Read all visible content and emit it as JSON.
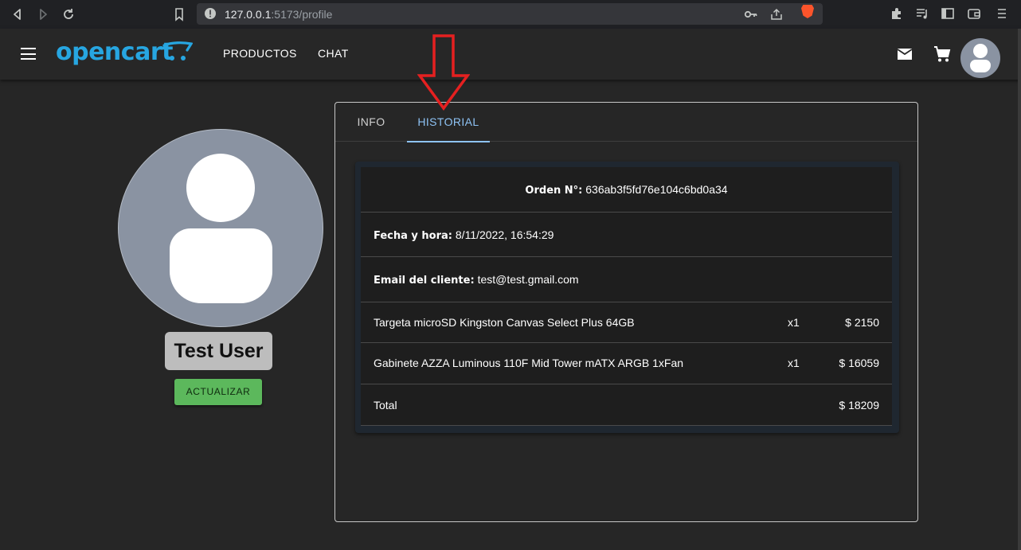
{
  "browser": {
    "url_host": "127.0.0.1",
    "url_path": ":5173/profile"
  },
  "header": {
    "logo": "opencart",
    "nav": [
      "PRODUCTOS",
      "CHAT"
    ]
  },
  "profile": {
    "user_name": "Test User",
    "update_button": "ACTUALIZAR"
  },
  "tabs": [
    "INFO",
    "HISTORIAL"
  ],
  "order": {
    "order_label": "Orden N°:",
    "order_id": "636ab3f5fd76e104c6bd0a34",
    "date_label": "Fecha y hora:",
    "date_value": "8/11/2022, 16:54:29",
    "email_label": "Email del cliente:",
    "email_value": "test@test.gmail.com",
    "items": [
      {
        "name": "Targeta microSD Kingston Canvas Select Plus 64GB",
        "qty": "x1",
        "price": "$ 2150"
      },
      {
        "name": "Gabinete AZZA Luminous 110F Mid Tower mATX ARGB 1xFan",
        "qty": "x1",
        "price": "$ 16059"
      }
    ],
    "total_label": "Total",
    "total_value": "$ 18209"
  },
  "colors": {
    "accent": "#27a6e1",
    "active_tab": "#8ec3f5",
    "update_button": "#5cb85c",
    "annotation_arrow": "#e52020"
  }
}
